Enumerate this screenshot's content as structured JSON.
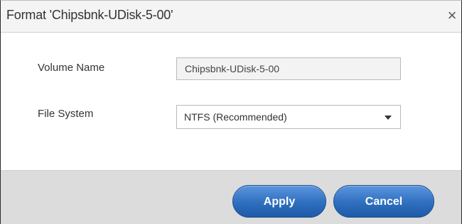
{
  "dialog": {
    "title": "Format 'Chipsbnk-UDisk-5-00'",
    "close_glyph": "×"
  },
  "form": {
    "volume_label": "Volume Name",
    "volume_value": "Chipsbnk-UDisk-5-00",
    "fs_label": "File System",
    "fs_value": "NTFS (Recommended)"
  },
  "footer": {
    "apply_label": "Apply",
    "cancel_label": "Cancel"
  },
  "colors": {
    "button_blue": "#2f6fbf",
    "footer_gray": "#dcdcdc"
  },
  "icons": {
    "close": "close-icon",
    "dropdown": "chevron-down-icon"
  }
}
